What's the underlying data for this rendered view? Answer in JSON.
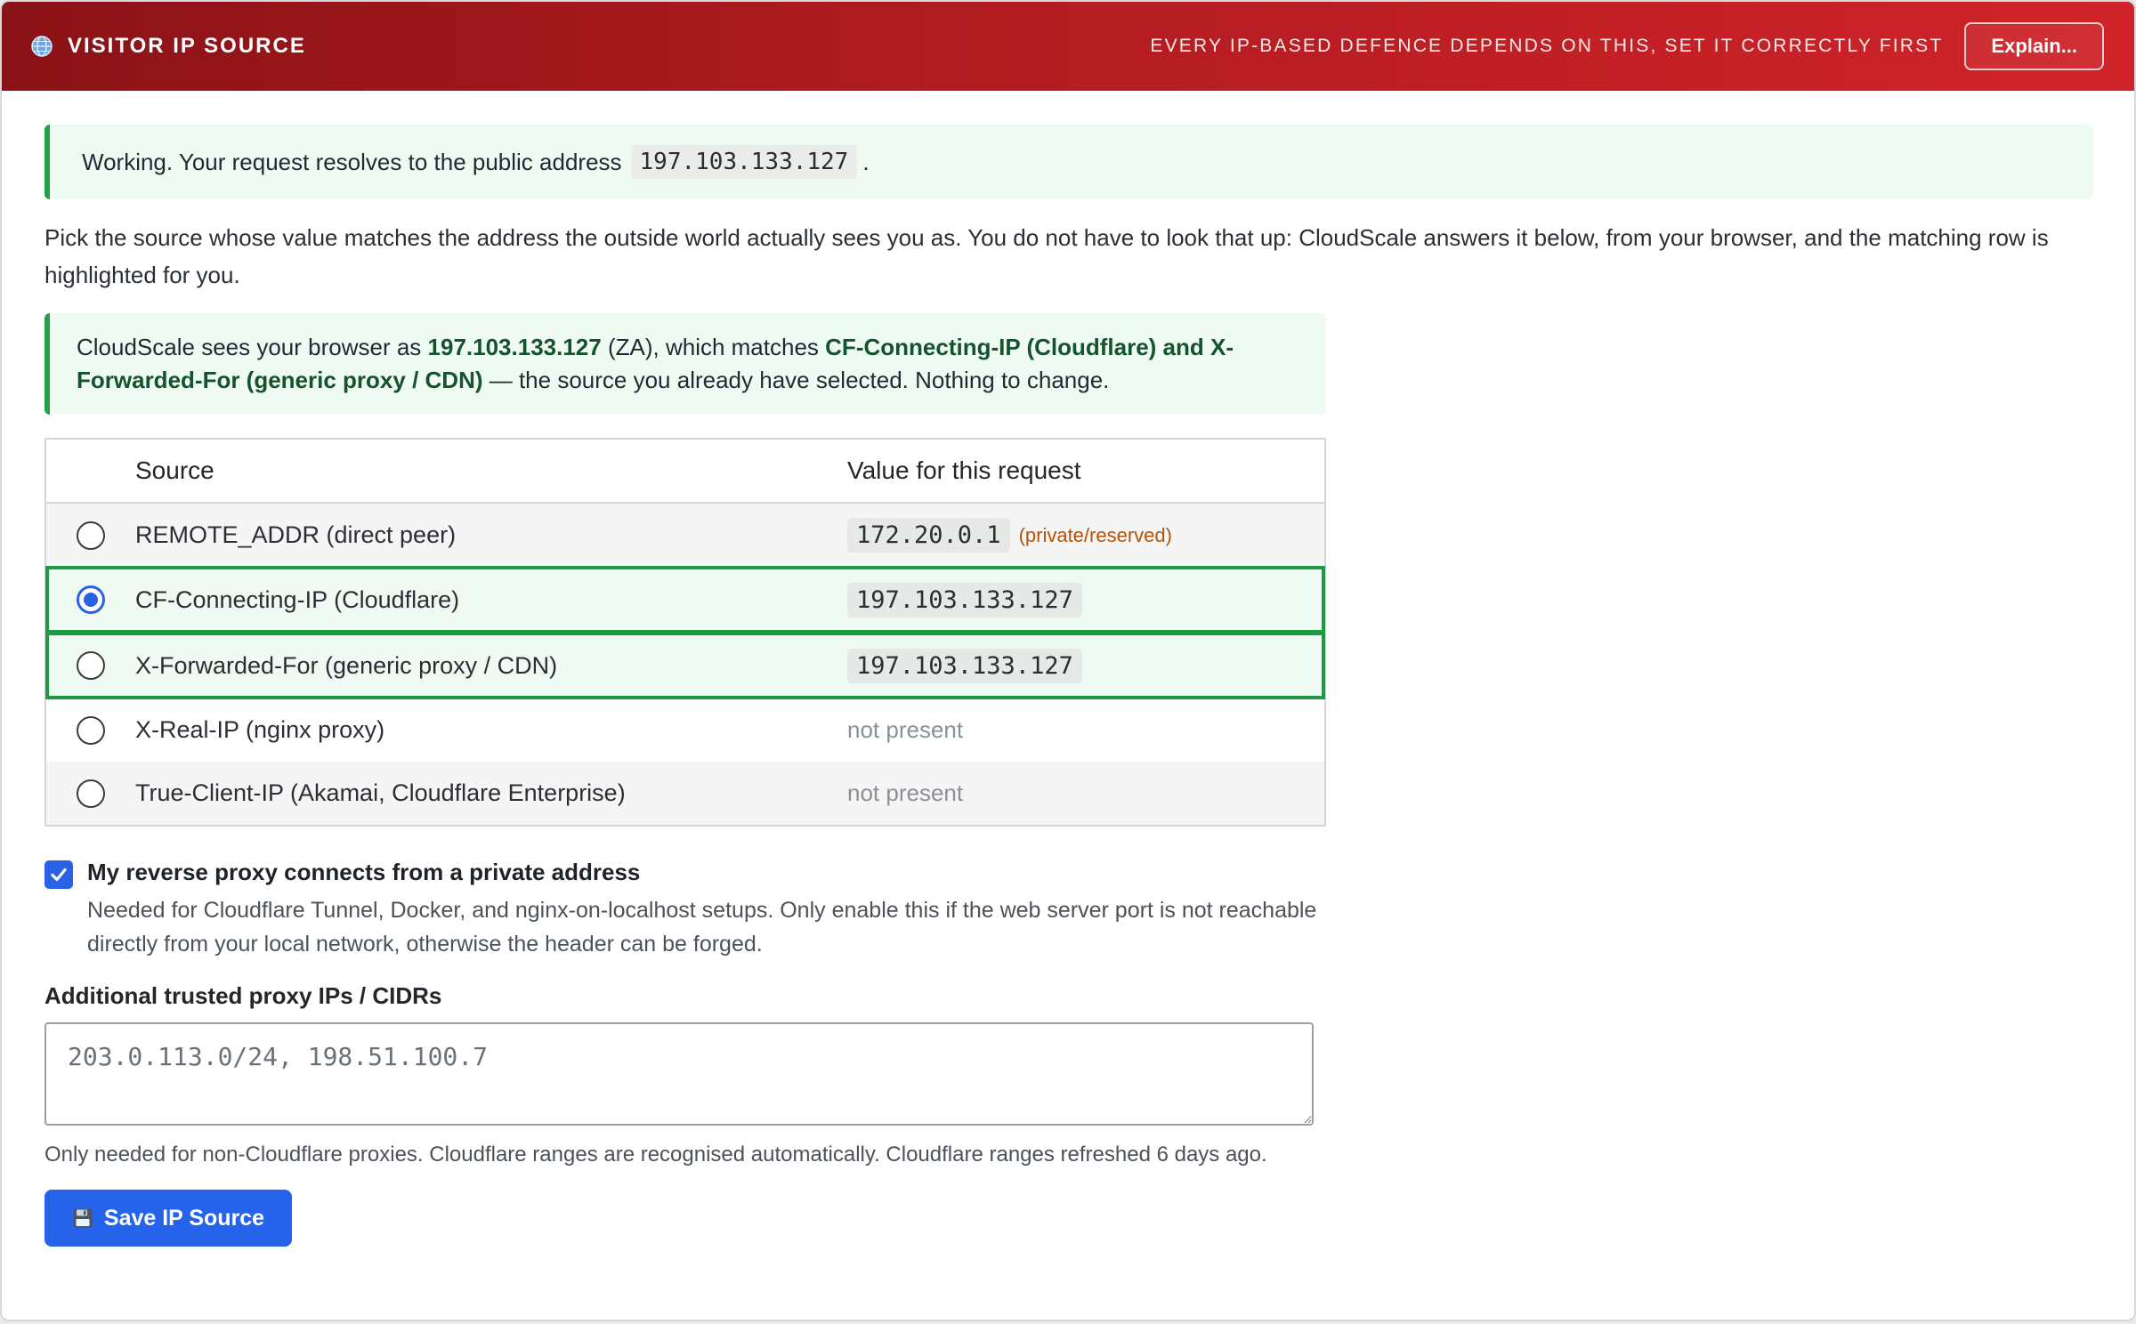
{
  "header": {
    "title": "VISITOR IP SOURCE",
    "tagline": "EVERY IP-BASED DEFENCE DEPENDS ON THIS, SET IT CORRECTLY FIRST",
    "explain_label": "Explain...",
    "globe_icon": "globe-icon",
    "colors": {
      "start": "#8a1216",
      "end": "#cf2329"
    }
  },
  "status": {
    "text_before": "Working. Your request resolves to the public address",
    "ip": "197.103.133.127",
    "text_after": "."
  },
  "intro": "Pick the source whose value matches the address the outside world actually sees you as. You do not have to look that up: CloudScale answers it below, from your browser, and the matching row is highlighted for you.",
  "match": {
    "prefix": "CloudScale sees your browser as",
    "ip": "197.103.133.127",
    "country": "(ZA), which matches",
    "sources": "CF-Connecting-IP (Cloudflare) and X-Forwarded-For (generic proxy / CDN)",
    "suffix": "— the source you already have selected. Nothing to change."
  },
  "table": {
    "headers": {
      "source": "Source",
      "value": "Value for this request"
    },
    "rows": [
      {
        "source": "REMOTE_ADDR (direct peer)",
        "value": "172.20.0.1",
        "note": "(private/reserved)",
        "selected": false,
        "matches": false
      },
      {
        "source": "CF-Connecting-IP (Cloudflare)",
        "value": "197.103.133.127",
        "note": "",
        "selected": true,
        "matches": true
      },
      {
        "source": "X-Forwarded-For (generic proxy / CDN)",
        "value": "197.103.133.127",
        "note": "",
        "selected": false,
        "matches": true
      },
      {
        "source": "X-Real-IP (nginx proxy)",
        "value": "not present",
        "note": "",
        "selected": false,
        "matches": false
      },
      {
        "source": "True-Client-IP (Akamai, Cloudflare Enterprise)",
        "value": "not present",
        "note": "",
        "selected": false,
        "matches": false
      }
    ]
  },
  "private_proxy": {
    "checked": true,
    "label": "My reverse proxy connects from a private address",
    "help": "Needed for Cloudflare Tunnel, Docker, and nginx-on-localhost setups. Only enable this if the web server port is not reachable directly from your local network, otherwise the header can be forged."
  },
  "trusted_proxies": {
    "label": "Additional trusted proxy IPs / CIDRs",
    "placeholder": "203.0.113.0/24, 198.51.100.7",
    "help": "Only needed for non-Cloudflare proxies. Cloudflare ranges are recognised automatically. Cloudflare ranges refreshed 6 days ago."
  },
  "save": {
    "label": "Save IP Source",
    "icon": "floppy-disk-icon",
    "color": "#2563eb"
  }
}
